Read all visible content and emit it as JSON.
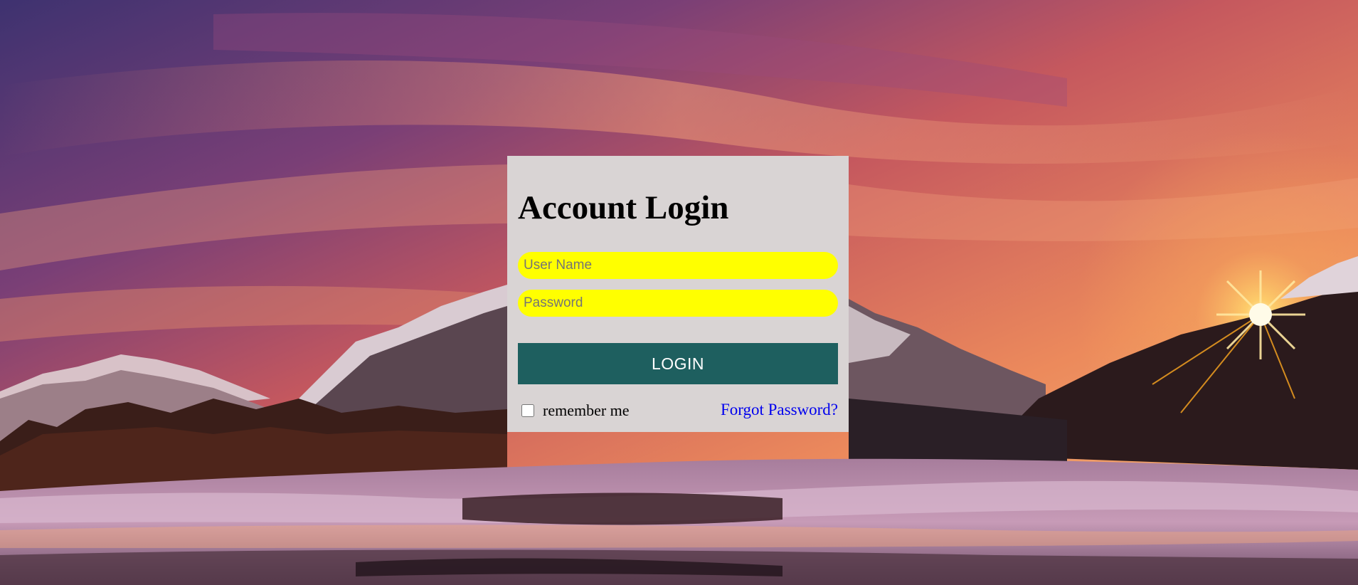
{
  "page": {
    "background": "sunset-mountain-lake"
  },
  "login": {
    "title": "Account Login",
    "username_placeholder": "User Name",
    "password_placeholder": "Password",
    "button_label": "LOGIN",
    "remember_label": "remember me",
    "forgot_label": "Forgot Password?",
    "remember_checked": false
  },
  "colors": {
    "panel": "#d9d4d4",
    "input_bg": "#ffff00",
    "button_bg": "#1e5f5f",
    "link": "#0000ee"
  }
}
